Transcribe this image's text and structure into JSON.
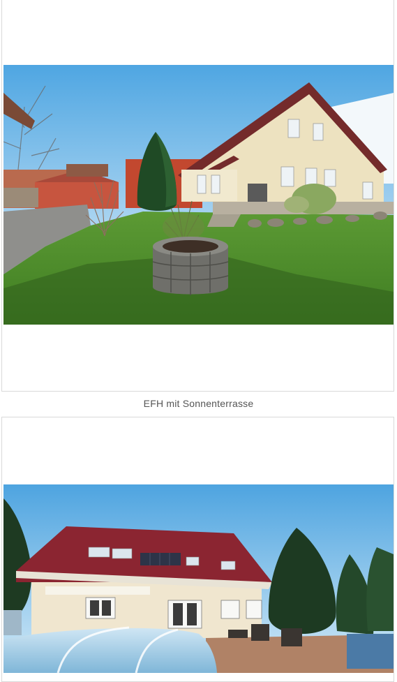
{
  "gallery": {
    "items": [
      {
        "caption": "EFH mit Sonnenterrasse",
        "photo_icon": "house-garden-photo",
        "colors": {
          "sky_top": "#5aaee4",
          "sky_bottom": "#d6ecf7",
          "lawn": "#4a8a2a",
          "wall": "#efe6c8",
          "roof": "#7a2d2d"
        }
      },
      {
        "caption": "",
        "photo_icon": "house-pool-photo",
        "colors": {
          "sky_top": "#5aaee4",
          "sky_bottom": "#cfe6f5",
          "roof": "#8a2430",
          "wall": "#f1e9d6",
          "tree": "#1f3d25"
        }
      }
    ]
  }
}
